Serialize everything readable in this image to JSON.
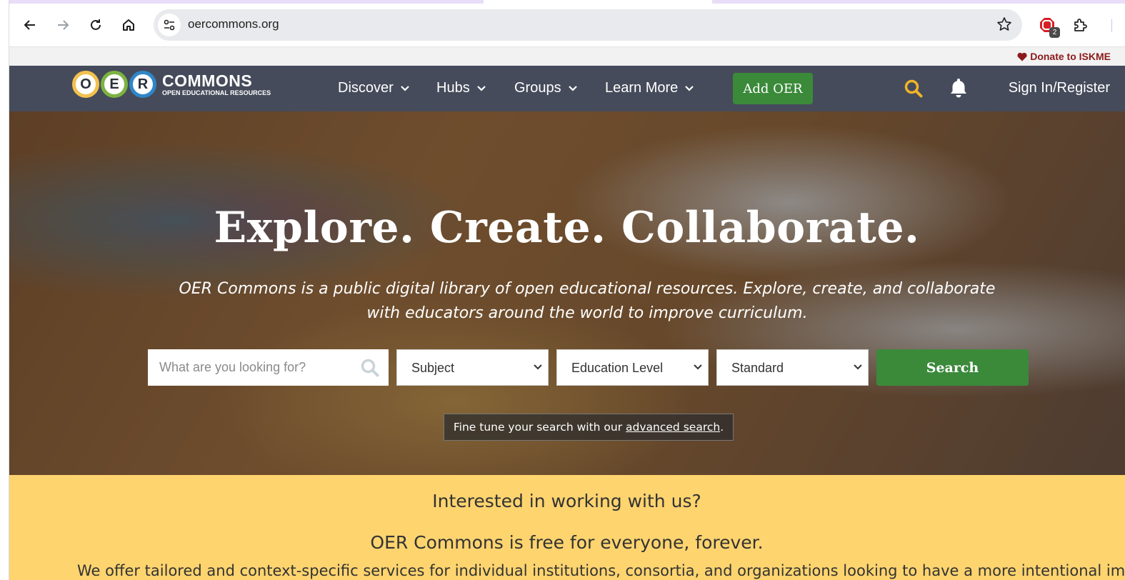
{
  "browser": {
    "url": "oercommons.org",
    "extension_badge": "2"
  },
  "donate": {
    "label": "Donate to ISKME"
  },
  "nav": {
    "logo_letters": [
      "O",
      "E",
      "R"
    ],
    "logo_title": "COMMONS",
    "logo_subtitle": "OPEN EDUCATIONAL RESOURCES",
    "menu": [
      {
        "label": "Discover"
      },
      {
        "label": "Hubs"
      },
      {
        "label": "Groups"
      },
      {
        "label": "Learn More"
      }
    ],
    "add_button": "Add OER",
    "signin": "Sign In/Register"
  },
  "hero": {
    "title": "Explore. Create. Collaborate.",
    "subtitle": "OER Commons is a public digital library of open educational resources. Explore, create, and collaborate with educators around the world to improve curriculum.",
    "search_placeholder": "What are you looking for?",
    "filters": [
      {
        "value": "Subject"
      },
      {
        "value": "Education Level"
      },
      {
        "value": "Standard"
      }
    ],
    "search_button": "Search",
    "finetune_prefix": "Fine tune your search with our ",
    "finetune_link": "advanced search",
    "finetune_suffix": "."
  },
  "band": {
    "heading": "Interested in working with us?",
    "subheading": "OER Commons is free for everyone, forever.",
    "text": "We offer tailored and context-specific services for individual institutions, consortia, and organizations looking to have a more intentional impact. As a"
  },
  "colors": {
    "nav_bg": "#454b5a",
    "accent_green": "#3b8a3a",
    "band_yellow": "#fed46f",
    "donate_red": "#8b1a1a",
    "search_icon_yellow": "#f0b429"
  }
}
